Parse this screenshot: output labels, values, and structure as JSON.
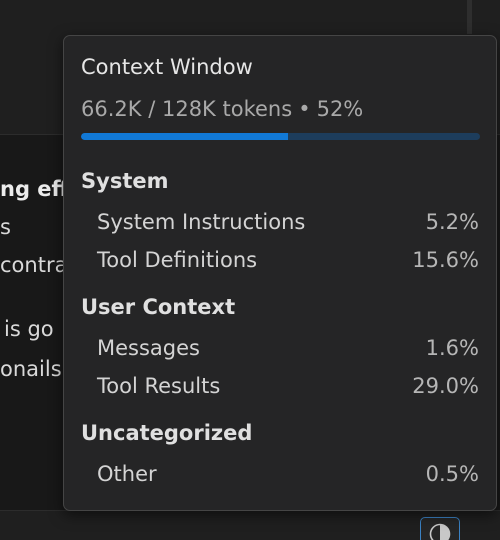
{
  "background": {
    "lines": [
      {
        "text": "ng eff",
        "bold": true
      },
      {
        "text": "s",
        "bold": false
      },
      {
        "text": "contra",
        "bold": false
      },
      {
        "text": "is go",
        "bold": false
      },
      {
        "text": "onails",
        "bold": false
      }
    ]
  },
  "context_button": {
    "icon": "pie-chart-icon",
    "accent": "#3b82c4"
  },
  "popup": {
    "title": "Context Window",
    "usage": {
      "used": "66.2K",
      "total": "128K",
      "unit": "tokens",
      "separator": "•",
      "percent_label": "52%",
      "percent_value": 0.52
    },
    "colors": {
      "progress_fill": "#1179d6",
      "progress_track": "#1d3d5c"
    },
    "sections": [
      {
        "heading": "System",
        "rows": [
          {
            "label": "System Instructions",
            "value": "5.2%"
          },
          {
            "label": "Tool Definitions",
            "value": "15.6%"
          }
        ]
      },
      {
        "heading": "User Context",
        "rows": [
          {
            "label": "Messages",
            "value": "1.6%"
          },
          {
            "label": "Tool Results",
            "value": "29.0%"
          }
        ]
      },
      {
        "heading": "Uncategorized",
        "rows": [
          {
            "label": "Other",
            "value": "0.5%"
          }
        ]
      }
    ]
  }
}
